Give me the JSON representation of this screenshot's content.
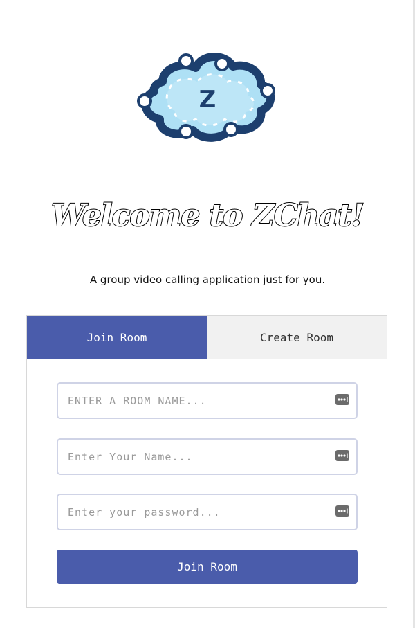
{
  "logo": {
    "letter": "Z",
    "icon": "cloud-logo-icon",
    "colors": {
      "outline": "#1d3f6e",
      "fill": "#aee0f5",
      "letter": "#1d3f6e"
    }
  },
  "header": {
    "title": "Welcome to ZChat!",
    "subtitle": "A group video calling application just for you."
  },
  "tabs": [
    {
      "label": "Join Room",
      "active": true
    },
    {
      "label": "Create Room",
      "active": false
    }
  ],
  "form": {
    "fields": [
      {
        "placeholder": "ENTER A ROOM NAME...",
        "value": "",
        "icon": "password-manager-icon"
      },
      {
        "placeholder": "Enter Your Name...",
        "value": "",
        "icon": "password-manager-icon"
      },
      {
        "placeholder": "Enter your password...",
        "value": "",
        "icon": "password-manager-icon"
      }
    ],
    "submit_label": "Join Room"
  },
  "colors": {
    "accent": "#4a5cab",
    "inactive_tab": "#f1f1f1",
    "field_border": "#cfd3e6"
  }
}
